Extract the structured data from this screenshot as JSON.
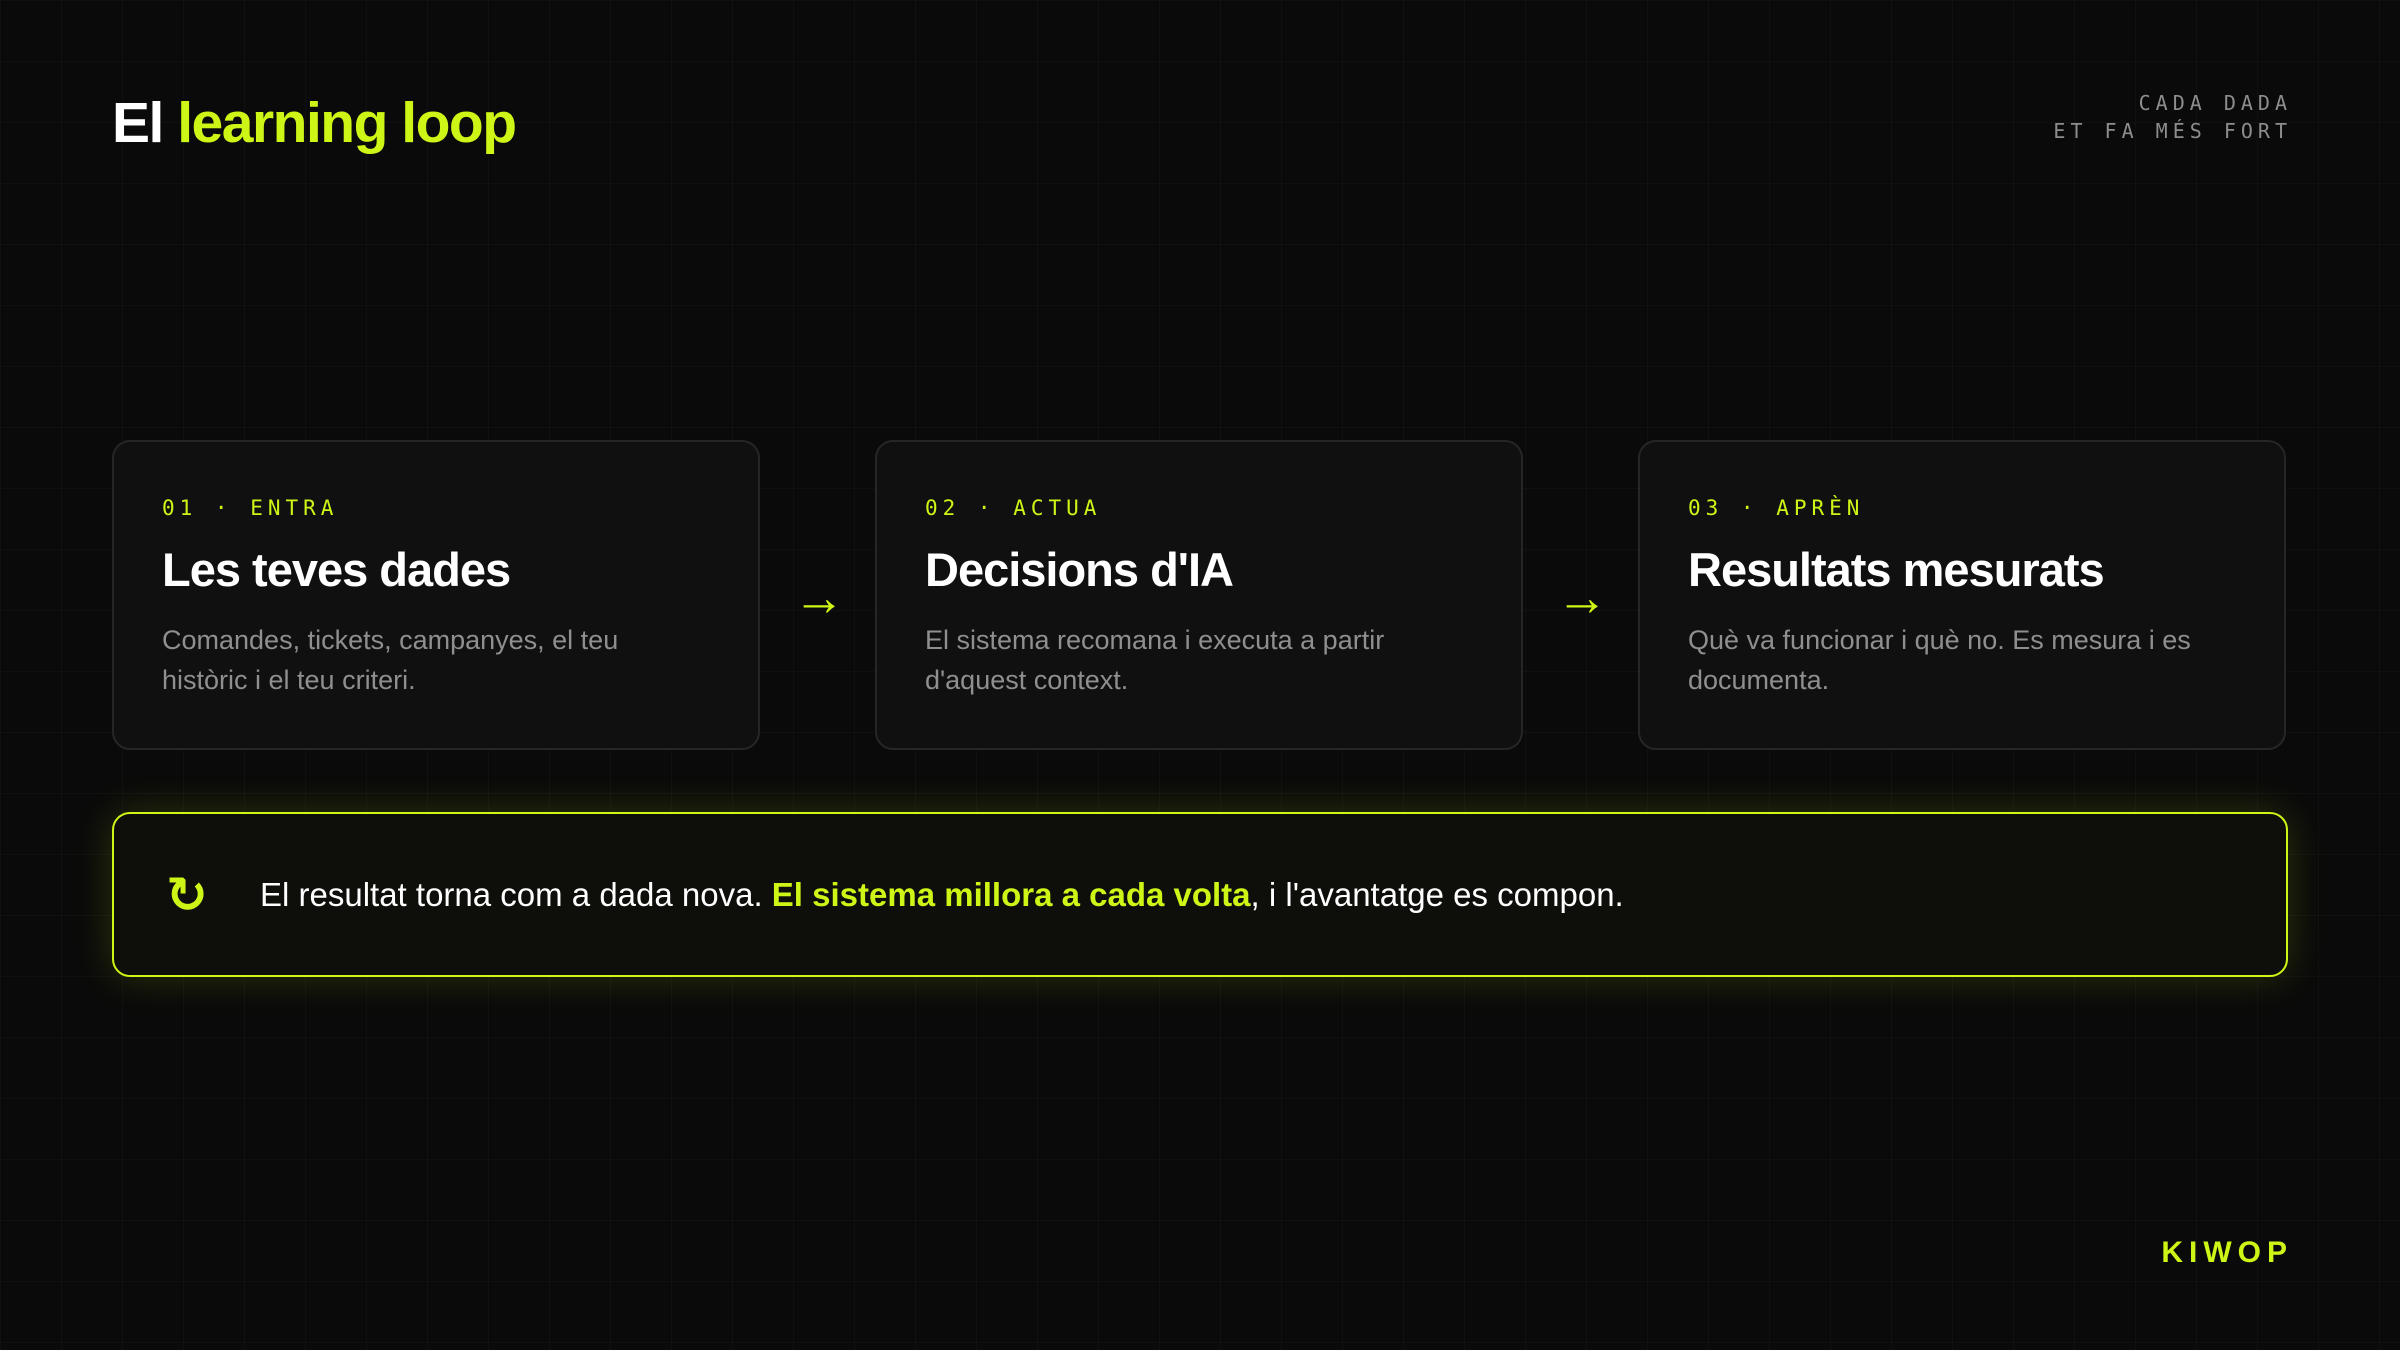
{
  "header": {
    "title_prefix": "El",
    "title_accent": "learning loop",
    "tagline_line1": "CADA DADA",
    "tagline_line2": "ET FA MÉS FORT"
  },
  "steps": [
    {
      "label": "01 · ENTRA",
      "title": "Les teves dades",
      "description": "Comandes, tickets, campanyes, el teu històric i el teu criteri."
    },
    {
      "label": "02 · ACTUA",
      "title": "Decisions d'IA",
      "description": "El sistema recomana i executa a partir d'aquest context."
    },
    {
      "label": "03 · APRÈN",
      "title": "Resultats mesurats",
      "description": "Què va funcionar i què no. Es mesura i es documenta."
    }
  ],
  "arrows": {
    "glyph": "→",
    "icon": "arrow-right-icon"
  },
  "loop": {
    "icon": "refresh-icon",
    "icon_glyph": "↻",
    "text_before": "El resultat torna com a dada nova. ",
    "text_highlight": "El sistema millora a cada volta",
    "text_after": ", i l'avantatge es compon."
  },
  "brand": {
    "name": "KIWOP"
  },
  "colors": {
    "background": "#0a0a0a",
    "accent": "#cdf516",
    "card_background": "#101010",
    "card_border": "#262626",
    "muted_text": "#8f8f8f"
  }
}
